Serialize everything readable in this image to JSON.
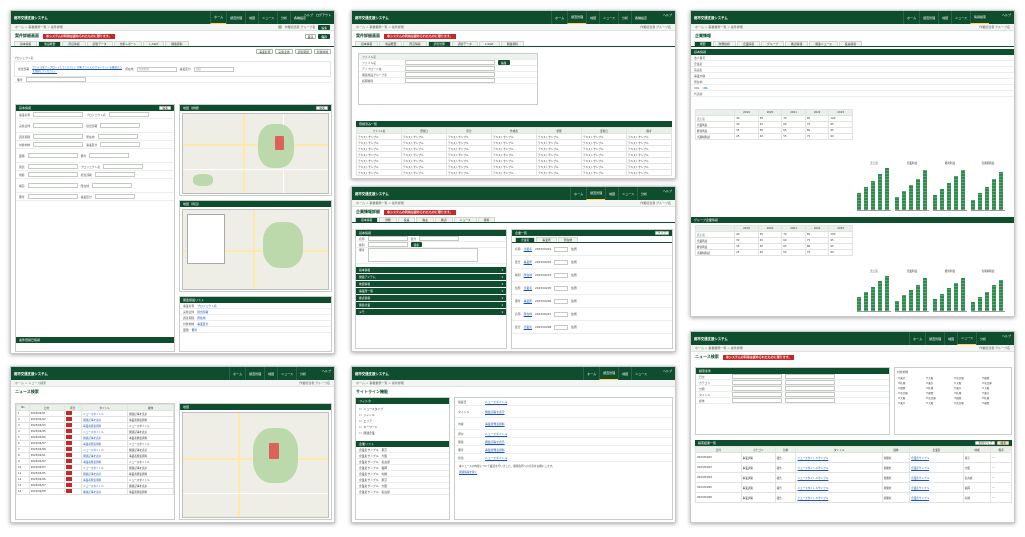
{
  "app": {
    "name": "都市交通支援システム",
    "nav": [
      "ホーム",
      "調査管理",
      "地図",
      "ニュース",
      "分析",
      "各種設定",
      "情報検索"
    ],
    "util": [
      "ヘルプ",
      "ログアウト"
    ],
    "user": "作業担当者 グループ名",
    "crumbs": "ホーム > 事業業務一覧 > 案件詳細"
  },
  "s1": {
    "title": "案件詳細画面",
    "alert": "本システムの利用は認められたものに限ります。",
    "tabs": [
      "基本情報",
      "施設概要",
      "周辺情報",
      "調査データ",
      "分析レポート",
      "L-SIGT",
      "関連資料"
    ],
    "labels": [
      "プロジェクト名",
      "担当部署",
      "所在地",
      "事業区分",
      "備考"
    ],
    "link_text": "ファイルをアップロードしてください。対象ファイルのフォーマットを確認のうえ登録してください。",
    "section": "基本情報",
    "map1": "地図（詳細）",
    "map2": "地図（周辺）",
    "list": "関連施設リスト",
    "footer": "案件登録日情報",
    "btn_save": "保存",
    "btn_edit": "編集",
    "btn_back": "戻る",
    "fields": [
      "事業名称",
      "実施主体",
      "調査期間",
      "対象地域",
      "面積",
      "用途",
      "規模",
      "構造",
      "備考"
    ]
  },
  "s2": {
    "title": "案件詳細画面",
    "alert": "本システムの利用は認められたものに限ります。",
    "tabs": [
      "基本情報",
      "施設概要",
      "周辺情報",
      "調査管理",
      "調査データ",
      "L-SIGT",
      "関連資料"
    ],
    "form": [
      "ファイル名",
      "アップロード先",
      "関連施設グループ名",
      "処理種別"
    ],
    "list_title": "登録済み一覧",
    "cols": [
      "ファイル名",
      "登録日",
      "区分",
      "作成者",
      "状態",
      "更新日",
      "備考"
    ],
    "cell": "テキストサンプル"
  },
  "s3": {
    "title": "企業情報",
    "tabs": [
      "概要",
      "財務指標",
      "企業情報",
      "グループ",
      "拠点情報",
      "関連ニュース",
      "役員情報"
    ],
    "section1": "基本情報",
    "section2": "グループ企業情報",
    "labels": [
      "法人番号",
      "企業名",
      "英語名",
      "事業内容",
      "所在地",
      "URL",
      "代表者"
    ],
    "chart_labels": [
      "売上高",
      "営業利益",
      "経常利益",
      "当期純利益"
    ],
    "years": [
      "2019",
      "2020",
      "2021",
      "2022",
      "2023"
    ]
  },
  "s4": {
    "title": "企業情報詳細",
    "alert": "本システムの利用は認められたものに限ります。",
    "tabs": [
      "基本情報",
      "財務",
      "役員",
      "株主",
      "拠点",
      "ニュース",
      "資料"
    ],
    "left_sections": [
      "基本情報",
      "関連アイテム",
      "地図情報",
      "事業所一覧",
      "拠点情報",
      "関連企業",
      "メモ"
    ],
    "right_title": "企業一覧",
    "right_tabs": [
      "企業名",
      "事業所",
      "所在地"
    ],
    "dates": [
      "2023/04/01",
      "2023/04/02",
      "2023/04/03",
      "2023/04/05",
      "2023/04/06",
      "2023/04/07",
      "2023/04/08"
    ],
    "field_labels": [
      "名称",
      "区分",
      "種別",
      "住所",
      "備考"
    ],
    "btn_search": "検索",
    "btn_clear": "クリア"
  },
  "s5": {
    "title": "ニュース検索",
    "crumbs": "ホーム > ニュース検索",
    "links": [
      "ニュースタイトル",
      "関連記事を表示",
      "事業者発表資料"
    ],
    "cols": [
      "No",
      "日付",
      "区分",
      "タイトル",
      "媒体"
    ],
    "map": "地図"
  },
  "s6": {
    "title": "サイトライン機能",
    "left_title": "フィルタ",
    "tree": [
      "ニュースタイプ",
      "ジャンル",
      "エリア",
      "キーワード",
      "関連企業"
    ],
    "left2": "企業リスト",
    "fields": [
      "掲載日",
      "タイトル",
      "内容",
      "添付",
      "関連",
      "備考",
      "担当"
    ],
    "note": "本ニュースの内容について確認を行いました。関係各所への共有をお願いします。",
    "sample_link": "関連情報を開く"
  },
  "s7": {
    "title": "ニュース検索",
    "alert": "本システムの利用は認められたものに限ります。",
    "panel_title": "検索条件",
    "right_title": "対象地域",
    "list_title": "検索結果一覧",
    "cols": [
      "日付",
      "カテゴリ",
      "分類",
      "タイトル",
      "媒体",
      "企業名",
      "地域",
      "備考"
    ],
    "rows": [
      [
        "2023/04/02",
        "事業調査",
        "報告",
        "ニュースタイトルサンプル",
        "新聞社",
        "企業名サンプル",
        "東京",
        "—"
      ],
      [
        "2023/04/03",
        "事業調査",
        "報告",
        "ニュースタイトルサンプル",
        "新聞社",
        "企業名サンプル",
        "大阪",
        "—"
      ],
      [
        "2023/04/04",
        "事業調査",
        "報告",
        "ニュースタイトルサンプル",
        "新聞社",
        "企業名サンプル",
        "名古屋",
        "—"
      ],
      [
        "2023/04/05",
        "事業調査",
        "報告",
        "ニュースタイトルサンプル",
        "新聞社",
        "企業名サンプル",
        "福岡",
        "—"
      ],
      [
        "2023/04/06",
        "事業調査",
        "報告",
        "ニュースタイトルサンプル",
        "新聞社",
        "企業名サンプル",
        "札幌",
        "—"
      ]
    ],
    "btn_search": "検索",
    "btn_reset": "条件クリア"
  },
  "colors": {
    "brand": "#0f4d2f",
    "accent": "#ffd24a",
    "alert": "#c62828",
    "chart": "#2e8b4e"
  },
  "chart_data": [
    {
      "type": "bar",
      "title": "売上高",
      "categories": [
        "2019",
        "2020",
        "2021",
        "2022",
        "2023"
      ],
      "values": [
        40,
        55,
        70,
        85,
        100
      ]
    },
    {
      "type": "bar",
      "title": "営業利益",
      "categories": [
        "2019",
        "2020",
        "2021",
        "2022",
        "2023"
      ],
      "values": [
        30,
        45,
        60,
        75,
        95
      ]
    },
    {
      "type": "bar",
      "title": "経常利益",
      "categories": [
        "2019",
        "2020",
        "2021",
        "2022",
        "2023"
      ],
      "values": [
        35,
        50,
        65,
        80,
        95
      ]
    },
    {
      "type": "bar",
      "title": "当期純利益",
      "categories": [
        "2019",
        "2020",
        "2021",
        "2022",
        "2023"
      ],
      "values": [
        25,
        40,
        55,
        75,
        90
      ]
    }
  ]
}
